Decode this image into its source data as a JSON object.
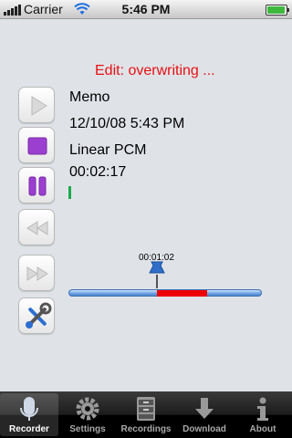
{
  "status_bar": {
    "carrier": "Carrier",
    "time": "5:46 PM",
    "battery_level": 1.0
  },
  "edit_status": "Edit: overwriting ...",
  "recording": {
    "name": "Memo",
    "datetime": "12/10/08 5:43 PM",
    "format": "Linear PCM",
    "duration": "00:02:17"
  },
  "timeline": {
    "marker_time": "00:01:02"
  },
  "controls": {
    "play": "play-icon",
    "stop": "stop-icon",
    "pause": "pause-icon",
    "rewind": "rewind-icon",
    "fast_forward": "fast-forward-icon",
    "tools": "tools-icon"
  },
  "tabs": [
    {
      "label": "Recorder",
      "icon": "microphone-icon",
      "active": true
    },
    {
      "label": "Settings",
      "icon": "gear-icon",
      "active": false
    },
    {
      "label": "Recordings",
      "icon": "cabinet-icon",
      "active": false
    },
    {
      "label": "Download",
      "icon": "download-icon",
      "active": false
    },
    {
      "label": "About",
      "icon": "info-icon",
      "active": false
    }
  ],
  "colors": {
    "edit_text": "#e81010",
    "selection": "#ee0000",
    "accent_purple": "#9b3fd0",
    "level": "#1aaa4a"
  }
}
